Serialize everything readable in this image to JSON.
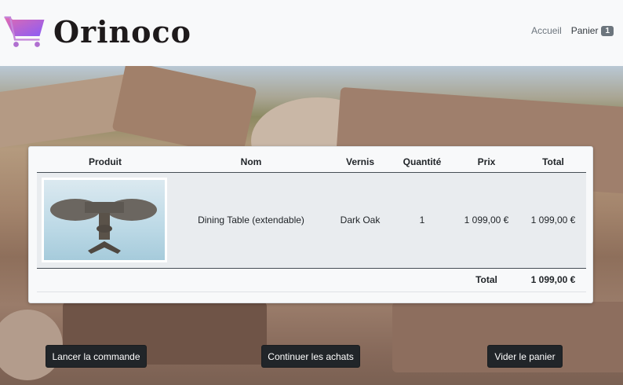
{
  "brand": {
    "name": "Orinoco",
    "logo_icon": "shopping-cart-icon"
  },
  "nav": {
    "home": "Accueil",
    "cart": "Panier",
    "cart_count": "1"
  },
  "table": {
    "headers": [
      "Produit",
      "Nom",
      "Vernis",
      "Quantité",
      "Prix",
      "Total"
    ],
    "rows": [
      {
        "image": "dining-table-photo",
        "name": "Dining Table (extendable)",
        "varnish": "Dark Oak",
        "quantity": "1",
        "price": "1 099,00 €",
        "total": "1 099,00 €"
      }
    ],
    "total_label": "Total",
    "total_value": "1 099,00 €"
  },
  "buttons": {
    "order": "Lancer la commande",
    "continue": "Continuer les achats",
    "empty": "Vider le panier"
  },
  "colors": {
    "button_bg": "#212529",
    "logo_gradient_start": "#e06bb0",
    "logo_gradient_end": "#8b5cf6"
  }
}
